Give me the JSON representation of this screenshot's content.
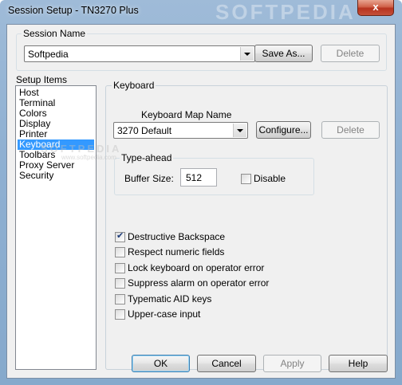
{
  "window": {
    "title": "Session Setup - TN3270 Plus",
    "close_glyph": "x"
  },
  "session_name": {
    "label": "Session Name",
    "value": "Softpedia",
    "save_as_label": "Save As...",
    "delete_label": "Delete"
  },
  "setup_items": {
    "label": "Setup Items",
    "items": [
      "Host",
      "Terminal",
      "Colors",
      "Display",
      "Printer",
      "Keyboard",
      "Toolbars",
      "Proxy Server",
      "Security"
    ],
    "selected": "Keyboard"
  },
  "keyboard": {
    "group_label": "Keyboard",
    "map_label": "Keyboard Map Name",
    "map_value": "3270 Default",
    "configure_label": "Configure...",
    "delete_label": "Delete",
    "typeahead_label": "Type-ahead",
    "buffer_size_label": "Buffer Size:",
    "buffer_size_value": "512",
    "disable_label": "Disable",
    "disable_checked": false,
    "options": [
      {
        "label": "Destructive Backspace",
        "checked": true
      },
      {
        "label": "Respect numeric fields",
        "checked": false
      },
      {
        "label": "Lock keyboard on operator error",
        "checked": false
      },
      {
        "label": "Suppress alarm on operator error",
        "checked": false
      },
      {
        "label": "Typematic AID keys",
        "checked": false
      },
      {
        "label": "Upper-case input",
        "checked": false
      }
    ]
  },
  "footer": {
    "ok_label": "OK",
    "cancel_label": "Cancel",
    "apply_label": "Apply",
    "help_label": "Help"
  },
  "watermark": {
    "title_text": "SOFTPEDIA",
    "mid_text": "SOFTPEDIA",
    "mid_sub": "www.softpedia.com"
  }
}
